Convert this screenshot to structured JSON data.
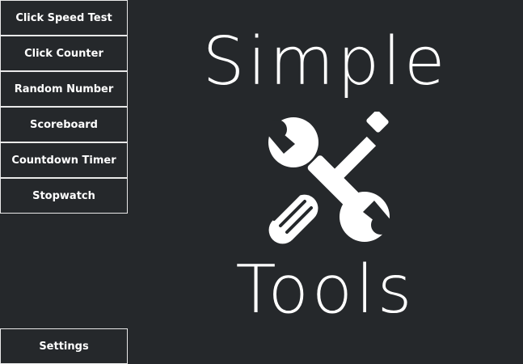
{
  "sidebar": {
    "items": [
      {
        "label": "Click Speed Test"
      },
      {
        "label": "Click Counter"
      },
      {
        "label": "Random Number"
      },
      {
        "label": "Scoreboard"
      },
      {
        "label": "Countdown Timer"
      },
      {
        "label": "Stopwatch"
      }
    ],
    "settings_label": "Settings"
  },
  "main": {
    "title_top": "Simple",
    "title_bottom": "Tools",
    "logo_icon": "wrench-screwdriver-icon"
  },
  "colors": {
    "background": "#25282b",
    "text": "#ffffff",
    "button_border": "#e9e9e9"
  }
}
